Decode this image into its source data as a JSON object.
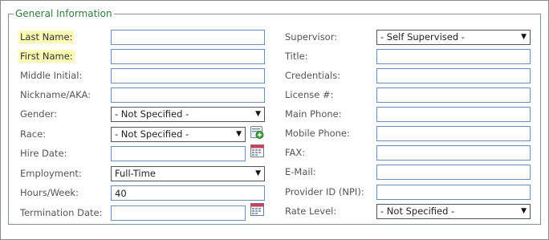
{
  "section": {
    "title": "General Information"
  },
  "left": {
    "last_name": {
      "label": "Last Name:",
      "value": ""
    },
    "first_name": {
      "label": "First Name:",
      "value": ""
    },
    "middle_initial": {
      "label": "Middle Initial:",
      "value": ""
    },
    "nickname": {
      "label": "Nickname/AKA:",
      "value": ""
    },
    "gender": {
      "label": "Gender:",
      "selected": "- Not Specified -"
    },
    "race": {
      "label": "Race:",
      "selected": "- Not Specified -"
    },
    "hire_date": {
      "label": "Hire Date:",
      "value": ""
    },
    "employment": {
      "label": "Employment:",
      "selected": "Full-Time"
    },
    "hours_week": {
      "label": "Hours/Week:",
      "value": "40"
    },
    "termination_date": {
      "label": "Termination Date:",
      "value": ""
    }
  },
  "right": {
    "supervisor": {
      "label": "Supervisor:",
      "selected": "- Self Supervised -"
    },
    "title": {
      "label": "Title:",
      "value": ""
    },
    "credentials": {
      "label": "Credentials:",
      "value": ""
    },
    "license": {
      "label": "License #:",
      "value": ""
    },
    "main_phone": {
      "label": "Main Phone:",
      "value": ""
    },
    "mobile_phone": {
      "label": "Mobile Phone:",
      "value": ""
    },
    "fax": {
      "label": "FAX:",
      "value": ""
    },
    "email": {
      "label": "E-Mail:",
      "value": ""
    },
    "provider_id": {
      "label": "Provider ID (NPI):",
      "value": ""
    },
    "rate_level": {
      "label": "Rate Level:",
      "selected": "- Not Specified -"
    }
  },
  "icons": {
    "calendar": "calendar-icon",
    "add": "add-race-icon",
    "dropdown": "▼"
  },
  "colors": {
    "legend": "#2f7d3b",
    "required_highlight": "#fbfbb4",
    "input_border": "#6a8fb5"
  }
}
